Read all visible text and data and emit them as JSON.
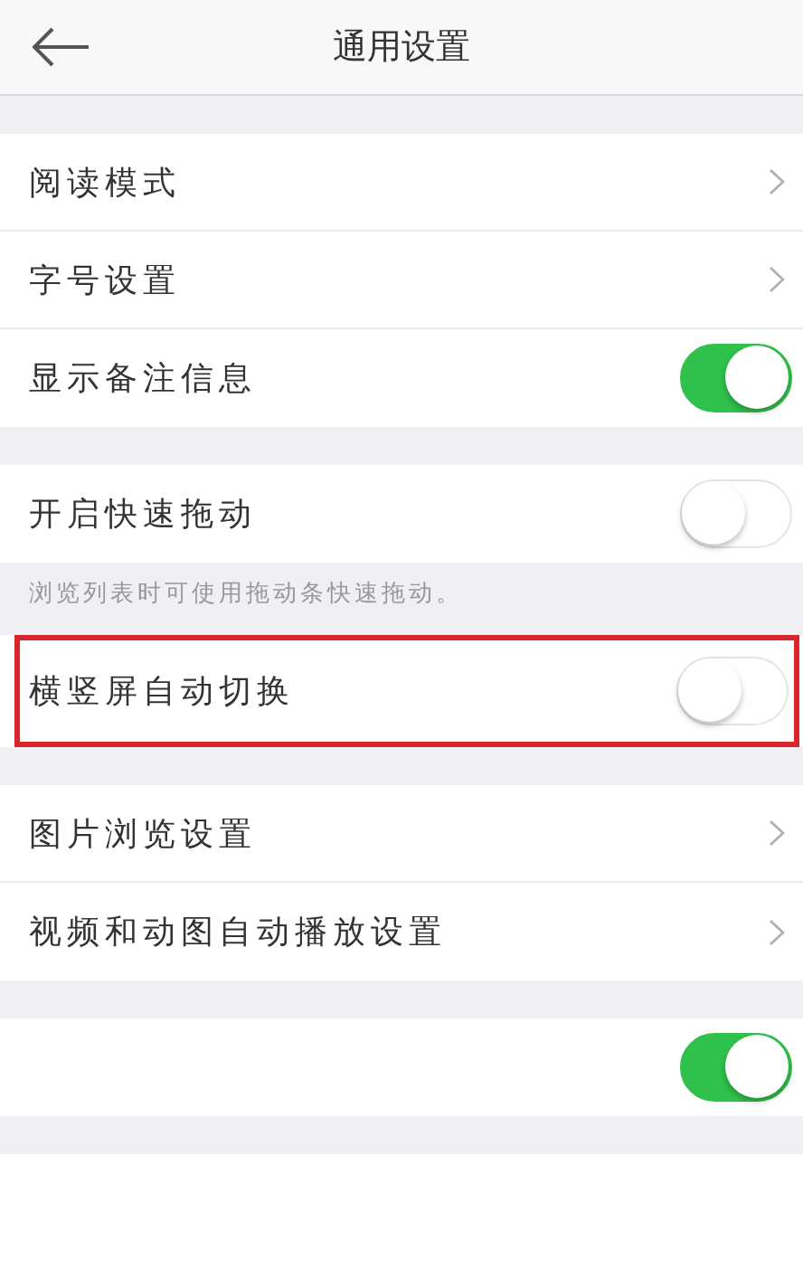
{
  "header": {
    "title": "通用设置"
  },
  "sections": [
    {
      "rows": [
        {
          "kind": "link",
          "label": "阅读模式"
        },
        {
          "kind": "link",
          "label": "字号设置"
        },
        {
          "kind": "toggle",
          "label": "显示备注信息",
          "on": true
        }
      ]
    },
    {
      "rows": [
        {
          "kind": "toggle",
          "label": "开启快速拖动",
          "on": false
        }
      ],
      "note": "浏览列表时可使用拖动条快速拖动。"
    },
    {
      "rows": [
        {
          "kind": "toggle",
          "label": "横竖屏自动切换",
          "on": false,
          "highlighted": true
        }
      ]
    },
    {
      "rows": [
        {
          "kind": "link",
          "label": "图片浏览设置"
        },
        {
          "kind": "link",
          "label": "视频和动图自动播放设置"
        }
      ]
    },
    {
      "rows": [
        {
          "kind": "toggle",
          "on": true
        }
      ]
    }
  ]
}
